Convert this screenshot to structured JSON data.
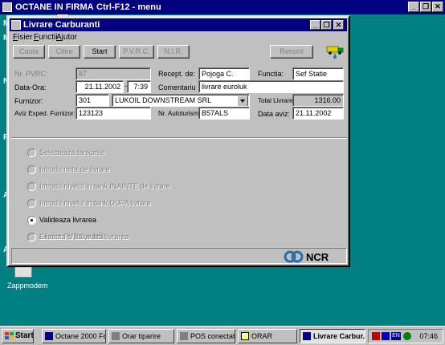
{
  "app": {
    "title": "OCTANE IN FIRMA",
    "shortcut": "Ctrl-F12 - menu",
    "min": "_",
    "restore": "❐",
    "close": "✕"
  },
  "desktop": {
    "side_letters": [
      "M",
      "M",
      "N",
      "P",
      "A",
      "A"
    ],
    "icon_label": "Zappmodem"
  },
  "window": {
    "title": "Livrare Carburanti",
    "min": "_",
    "restore": "❐",
    "close": "✕"
  },
  "menu": {
    "items": [
      {
        "hot": "F",
        "rest": "isier"
      },
      {
        "hot": "F",
        "rest": "unctii"
      },
      {
        "hot": "A",
        "rest": "jutor"
      }
    ]
  },
  "toolbar": {
    "cauta": "Cauta",
    "citire": "Citire",
    "start": "Start",
    "pvrc": "P.V.R.C.",
    "nir": "N.I.R.",
    "renunt": "Renunt"
  },
  "form": {
    "nr_pvrc_label": "Nr. PVRC:",
    "nr_pvrc_value": "87",
    "recept_label": "Recept. de:",
    "recept_value": "Pojoga C.",
    "functia_label": "Functia:",
    "functia_value": "Sef Statie",
    "data_ora_label": "Data-Ora:",
    "date_value": "21.11.2002",
    "time_value": "7:39",
    "comentariu_label": "Comentariu",
    "comentariu_value": "livrare euroluk",
    "furnizor_label": "Furnizor:",
    "furnizor_code": "301",
    "furnizor_name": "LUKOIL DOWNSTREAM SRL",
    "total_label": "Total Livrare:",
    "total_value": "1316.00",
    "aviz_label": "Aviz Exped. Furnizor:",
    "aviz_value": "123123",
    "auto_label": "Nr. Autoturism:",
    "auto_value": "B57ALS",
    "data_aviz_label": "Data aviz:",
    "data_aviz_value": "21.11.2002"
  },
  "steps": [
    {
      "label": "Selecteaza tankurile",
      "enabled": false,
      "selected": false
    },
    {
      "label": "Introdu nota de livrare",
      "enabled": false,
      "selected": false
    },
    {
      "label": "Introdu nivelul in tank INAINTE de livrare",
      "enabled": false,
      "selected": false
    },
    {
      "label": "Introdu nivelul in tank DUPA livrare",
      "enabled": false,
      "selected": false
    },
    {
      "label": "Valideaza livrarea",
      "enabled": true,
      "selected": true
    },
    {
      "label": "Afisare PVRC si NIR",
      "enabled": false,
      "selected": false
    },
    {
      "label": "Executa si salveaza livrarea",
      "enabled": false,
      "selected": false
    }
  ],
  "logo": {
    "text": "NCR",
    "color": "#2a6fa8"
  },
  "taskbar": {
    "start": "Start",
    "tasks": [
      {
        "label": "Octane 2000 Fo...",
        "icon": "window-icon"
      },
      {
        "label": "Orar tiparire",
        "icon": "window-icon"
      },
      {
        "label": "POS conectat",
        "icon": "window-icon"
      },
      {
        "label": "ORAR",
        "icon": "window-icon"
      },
      {
        "label": "Livrare Carbur...",
        "icon": "window-icon"
      }
    ],
    "lang": "EN",
    "clock": "07:46"
  },
  "colors": {
    "desktop": "#008080",
    "titlebar": "#000080",
    "face": "#c0c0c0"
  }
}
